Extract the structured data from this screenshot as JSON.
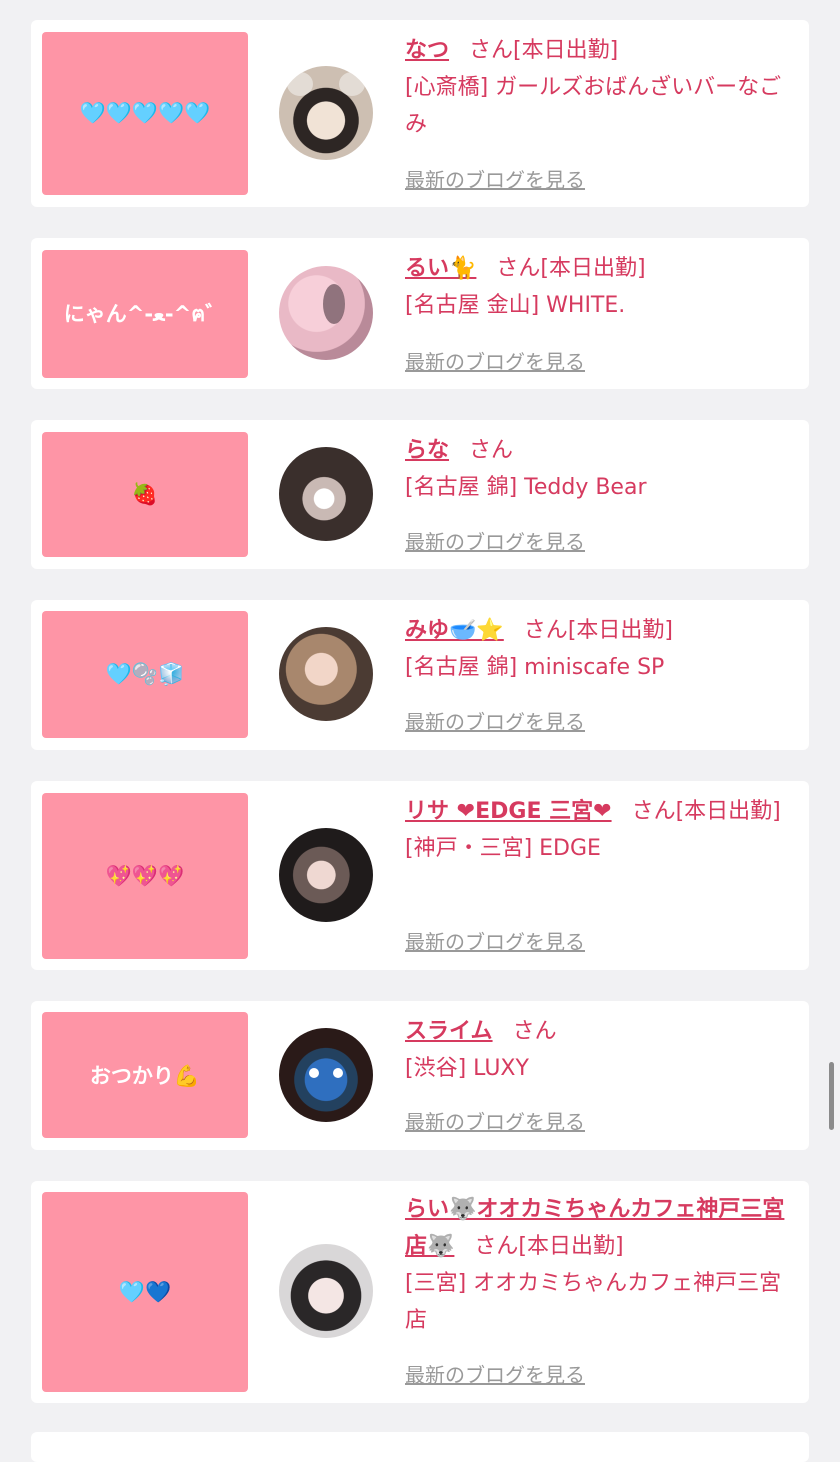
{
  "accent_color": "#d63a5f",
  "bubble_color": "#fe95a6",
  "entries": [
    {
      "bubble": "🩵🩵🩵🩵🩵",
      "name": "なつ",
      "san": "さん",
      "status": "[本日出勤]",
      "shop": "[心斎橋] ガールズおばんざいバーなごみ",
      "blog": "最新のブログを見る",
      "avatar_icon": "profile-photo"
    },
    {
      "bubble": "にゃん^-ﻌ-^ฅ゛",
      "name": "るい🐈",
      "san": "さん",
      "status": "[本日出勤]",
      "shop": "[名古屋 金山] WHITE.",
      "blog": "最新のブログを見る",
      "avatar_icon": "profile-photo"
    },
    {
      "bubble": "🍓",
      "name": "らな",
      "san": "さん",
      "status": "",
      "shop": "[名古屋 錦] Teddy Bear",
      "blog": "最新のブログを見る",
      "avatar_icon": "profile-photo"
    },
    {
      "bubble": "🩵🫧🧊",
      "name": "みゆ🥣⭐",
      "san": "さん",
      "status": "[本日出勤]",
      "shop": "[名古屋 錦] miniscafe SP",
      "blog": "最新のブログを見る",
      "avatar_icon": "profile-photo"
    },
    {
      "bubble": "💖💖💖",
      "name": "リサ ❤EDGE 三宮❤",
      "san": "さん",
      "status": "[本日出勤]",
      "shop": "[神戸・三宮] EDGE",
      "blog": "最新のブログを見る",
      "avatar_icon": "profile-photo"
    },
    {
      "bubble": "おつかり💪",
      "name": "スライム",
      "san": "さん",
      "status": "",
      "shop": "[渋谷] LUXY",
      "blog": "最新のブログを見る",
      "avatar_icon": "profile-photo"
    },
    {
      "bubble": "🩵💙",
      "name": "らい🐺オオカミちゃんカフェ神戸三宮店🐺",
      "san": "さん",
      "status": "[本日出勤]",
      "shop": "[三宮] オオカミちゃんカフェ神戸三宮店",
      "blog": "最新のブログを見る",
      "avatar_icon": "profile-photo"
    }
  ]
}
